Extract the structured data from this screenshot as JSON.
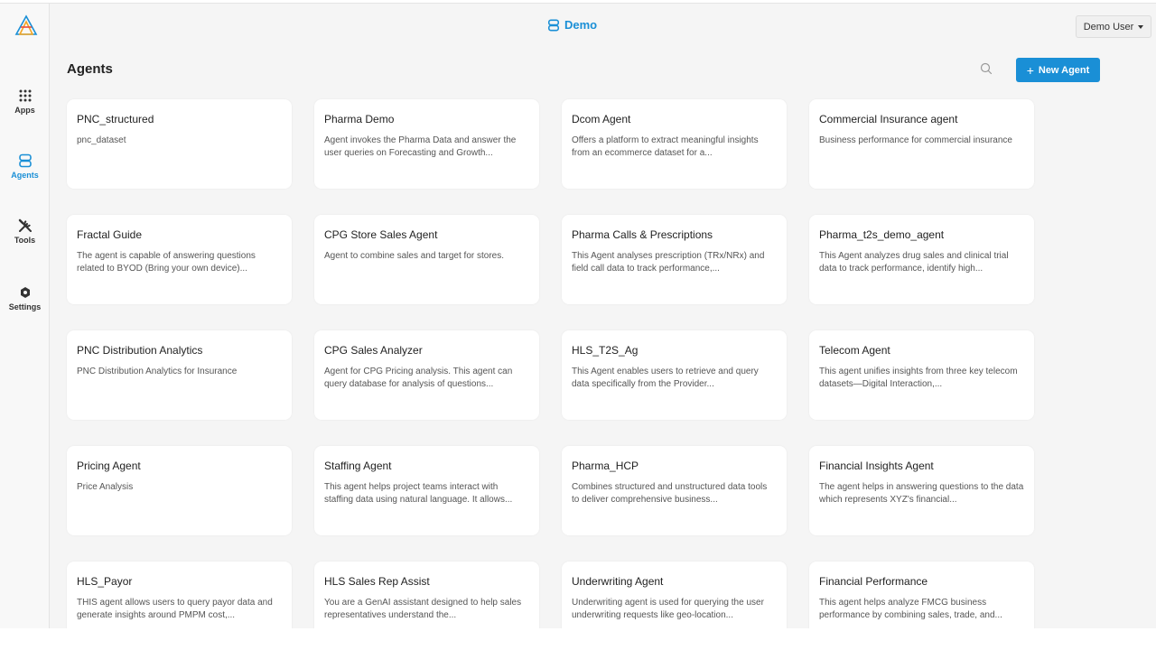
{
  "app": {
    "header_title": "Demo",
    "user_label": "Demo User",
    "brand_color": "#1a8fd6"
  },
  "sidebar": {
    "items": [
      {
        "label": "Apps",
        "icon": "apps-grid-icon"
      },
      {
        "label": "Agents",
        "icon": "agents-icon",
        "active": true
      },
      {
        "label": "Tools",
        "icon": "tools-icon"
      },
      {
        "label": "Settings",
        "icon": "settings-icon"
      }
    ]
  },
  "toolbar": {
    "page_title": "Agents",
    "new_agent_label": "New Agent"
  },
  "agents": [
    {
      "title": "PNC_structured",
      "description": "pnc_dataset"
    },
    {
      "title": "Pharma Demo",
      "description": "Agent invokes the Pharma Data and answer the user queries on Forecasting and Growth..."
    },
    {
      "title": "Dcom Agent",
      "description": "Offers a platform to extract meaningful insights from an ecommerce dataset for a..."
    },
    {
      "title": "Commercial Insurance agent",
      "description": "Business performance for commercial insurance"
    },
    {
      "title": "Fractal Guide",
      "description": "The agent is capable of answering questions related to BYOD (Bring your own device)..."
    },
    {
      "title": "CPG Store Sales Agent",
      "description": "Agent to combine sales and target for stores."
    },
    {
      "title": "Pharma Calls & Prescriptions",
      "description": "This Agent analyses prescription (TRx/NRx) and field call data to track performance,..."
    },
    {
      "title": "Pharma_t2s_demo_agent",
      "description": "This Agent analyzes drug sales and clinical trial data to track performance, identify high..."
    },
    {
      "title": "PNC Distribution Analytics",
      "description": "PNC Distribution Analytics for Insurance"
    },
    {
      "title": "CPG Sales Analyzer",
      "description": "Agent for CPG Pricing analysis. This agent can query database for analysis of questions..."
    },
    {
      "title": "HLS_T2S_Ag",
      "description": "This Agent enables users to retrieve and query data specifically from the Provider..."
    },
    {
      "title": "Telecom Agent",
      "description": "This agent unifies insights from three key telecom datasets—Digital Interaction,..."
    },
    {
      "title": "Pricing Agent",
      "description": "Price Analysis"
    },
    {
      "title": "Staffing Agent",
      "description": "This agent helps project teams interact with staffing data using natural language. It allows..."
    },
    {
      "title": "Pharma_HCP",
      "description": "Combines structured and unstructured data tools to deliver comprehensive business..."
    },
    {
      "title": "Financial Insights Agent",
      "description": "The agent helps in answering questions to the data which represents XYZ's financial..."
    },
    {
      "title": "HLS_Payor",
      "description": "THIS agent allows users to query payor data and generate insights around PMPM cost,..."
    },
    {
      "title": "HLS Sales Rep Assist",
      "description": "You are a GenAI assistant designed to help sales representatives understand the..."
    },
    {
      "title": "Underwriting Agent",
      "description": "Underwriting agent is used for querying the user underwriting requests like geo-location..."
    },
    {
      "title": "Financial Performance",
      "description": "This agent helps analyze FMCG business performance by combining sales, trade, and..."
    }
  ]
}
